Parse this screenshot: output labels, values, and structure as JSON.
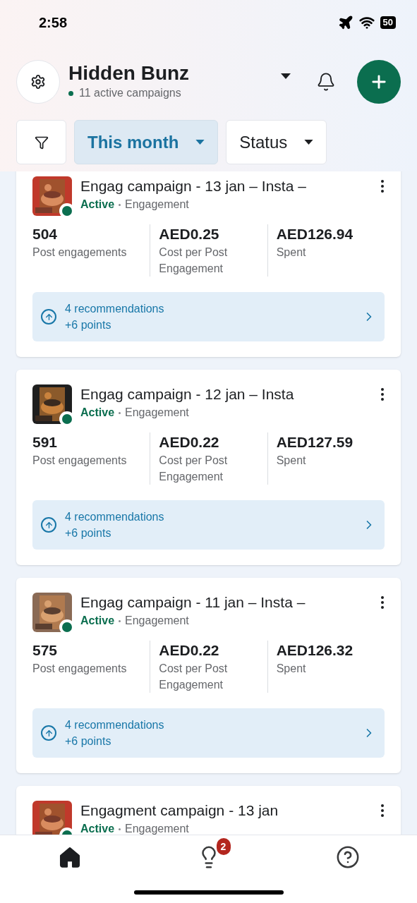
{
  "status_bar": {
    "time": "2:58",
    "battery": "50"
  },
  "header": {
    "account": "Hidden Bunz",
    "subtitle": "11 active campaigns"
  },
  "filters": [
    {
      "label": "This month",
      "selected": true
    },
    {
      "label": "Status",
      "selected": false
    }
  ],
  "campaigns": [
    {
      "name": "Engag campaign - 13 jan – Insta –",
      "status": "Active",
      "objective": "Engagement",
      "metrics": [
        {
          "value": "504",
          "label": "Post engagements"
        },
        {
          "value": "AED0.25",
          "label": "Cost per Post Engagement"
        },
        {
          "value": "AED126.94",
          "label": "Spent"
        }
      ],
      "recommendations": "4 recommendations",
      "points": "+6 points"
    },
    {
      "name": "Engag campaign - 12 jan – Insta",
      "status": "Active",
      "objective": "Engagement",
      "metrics": [
        {
          "value": "591",
          "label": "Post engagements"
        },
        {
          "value": "AED0.22",
          "label": "Cost per Post Engagement"
        },
        {
          "value": "AED127.59",
          "label": "Spent"
        }
      ],
      "recommendations": "4 recommendations",
      "points": "+6 points"
    },
    {
      "name": "Engag campaign - 11 jan – Insta –",
      "status": "Active",
      "objective": "Engagement",
      "metrics": [
        {
          "value": "575",
          "label": "Post engagements"
        },
        {
          "value": "AED0.22",
          "label": "Cost per Post Engagement"
        },
        {
          "value": "AED126.32",
          "label": "Spent"
        }
      ],
      "recommendations": "4 recommendations",
      "points": "+6 points"
    },
    {
      "name": "Engagment campaign - 13 jan",
      "status": "Active",
      "objective": "Engagement"
    }
  ],
  "nav": [
    {
      "kind": "home",
      "selected": true
    },
    {
      "kind": "ideas",
      "selected": false,
      "badge": "2"
    },
    {
      "kind": "help",
      "selected": false
    }
  ]
}
